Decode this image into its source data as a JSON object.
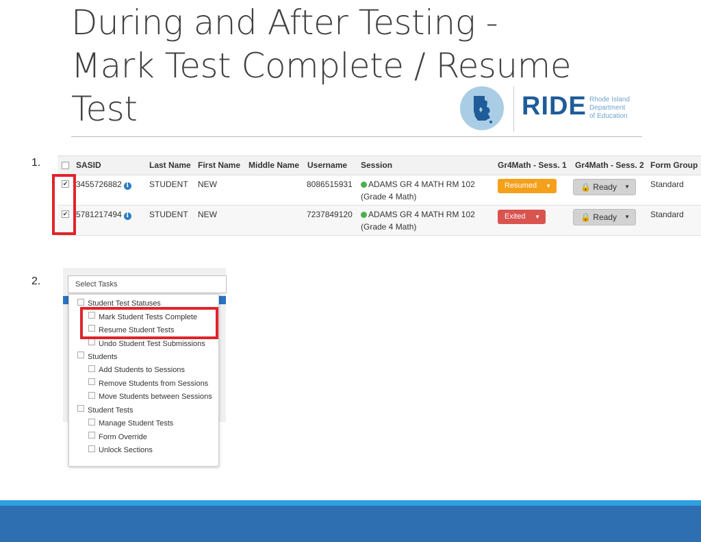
{
  "title_lines": [
    "During and After Testing -",
    "Mark Test Complete / Resume",
    "Test"
  ],
  "logo": {
    "name": "RIDE",
    "subtitle": [
      "Rhode Island",
      "Department",
      "of Education"
    ]
  },
  "steps": [
    "1.",
    "2."
  ],
  "table": {
    "headers": [
      "SASID",
      "Last Name",
      "First Name",
      "Middle Name",
      "Username",
      "Session",
      "Gr4Math - Sess. 1",
      "Gr4Math - Sess. 2",
      "Form Group"
    ],
    "rows": [
      {
        "checked": true,
        "sasid": "3455726882",
        "last_name": "STUDENT",
        "first_name": "NEW",
        "username": "8086515931",
        "session": "ADAMS GR 4 MATH RM 102",
        "session_sub": "(Grade 4 Math)",
        "sess1_status": "Resumed",
        "sess1_color": "#f5a01a",
        "sess2_status": "Ready",
        "form_group": "Standard"
      },
      {
        "checked": true,
        "sasid": "5781217494",
        "last_name": "STUDENT",
        "first_name": "NEW",
        "username": "7237849120",
        "session": "ADAMS GR 4 MATH RM 102",
        "session_sub": "(Grade 4 Math)",
        "sess1_status": "Exited",
        "sess1_color": "#d9534f",
        "sess2_status": "Ready",
        "form_group": "Standard"
      }
    ]
  },
  "tasks": {
    "select_label": "Select Tasks",
    "groups": [
      {
        "label": "Student Test Statuses",
        "items": [
          "Mark Student Tests Complete",
          "Resume Student Tests",
          "Undo Student Test Submissions"
        ]
      },
      {
        "label": "Students",
        "items": [
          "Add Students to Sessions",
          "Remove Students from Sessions",
          "Move Students between Sessions"
        ]
      },
      {
        "label": "Student Tests",
        "items": [
          "Manage Student Tests",
          "Form Override",
          "Unlock Sections"
        ]
      }
    ]
  },
  "colors": {
    "highlight": "#e0232c",
    "brand_blue": "#1f5c99",
    "footer_band": "#2e6fb2"
  }
}
